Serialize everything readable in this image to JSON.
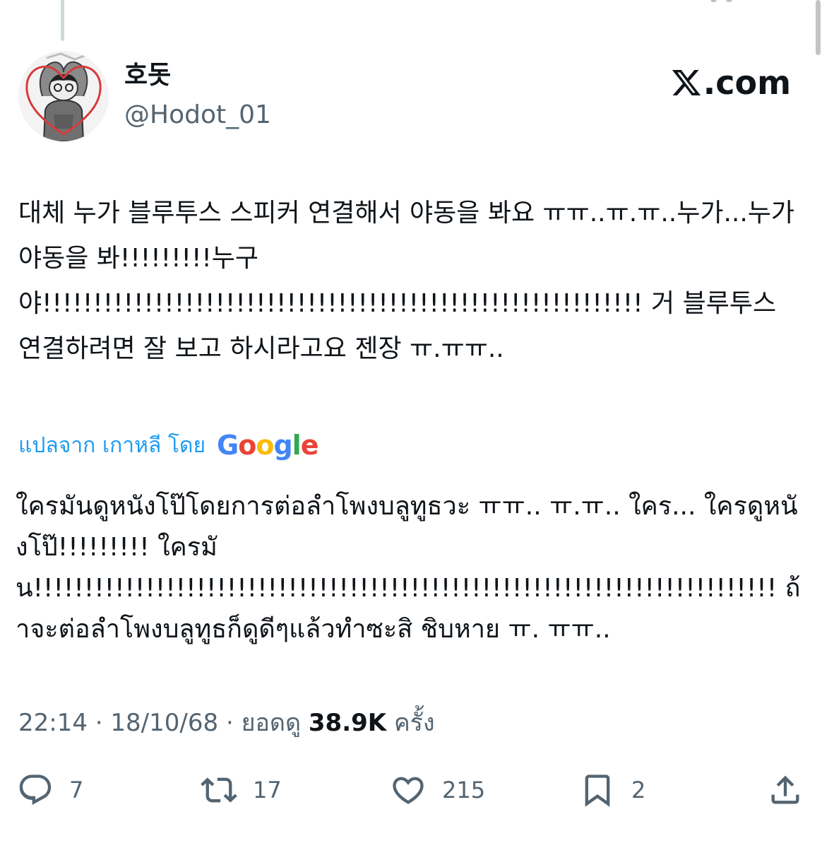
{
  "author": {
    "display_name": "호돗",
    "handle": "@Hodot_01"
  },
  "brand": {
    "label": ".com"
  },
  "tweet": {
    "text": "대체 누가 블루투스 스피커 연결해서 야동을 봐요 ㅠㅠ..ㅠ.ㅠ..누가...누가 야동을 봐!!!!!!!!!누구야!!!!!!!!!!!!!!!!!!!!!!!!!!!!!!!!!!!!!!!!!!!!!!!!!!!!!!!!!!! 거 블루투스 연결하려면 잘 보고 하시라고요 젠장 ㅠ.ㅠㅠ.."
  },
  "translation": {
    "label": "แปลจาก เกาหลี โดย",
    "provider": "Google",
    "text": "ใครมันดูหนังโป๊โดยการต่อลำโพงบลูทูธวะ ㅠㅠ.. ㅠ.ㅠ.. ใคร... ใครดูหนังโป๊!!!!!!!!! ใครมัน!!!!!!!!!!!!!!!!!!!!!!!!!!!!!!!!!!!!!!!!!!!!!!!!!!!!!!!!!!!!!!!!!!!!!!!!! ถ้าจะต่อลำโพงบลูทูธก็ดูดีๆแล้วทำซะสิ ชิบหาย ㅠ. ㅠㅠ.."
  },
  "meta": {
    "time": "22:14",
    "date": "18/10/68",
    "views_label": "ยอดดู",
    "views_count": "38.9K",
    "views_suffix": "ครั้ง"
  },
  "actions": {
    "replies": "7",
    "reposts": "17",
    "likes": "215",
    "bookmarks": "2"
  },
  "colors": {
    "link": "#1d9bf0",
    "secondary_text": "#536471",
    "primary_text": "#0f1419"
  },
  "icons": [
    "reply-icon",
    "repost-icon",
    "like-icon",
    "bookmark-icon",
    "share-icon",
    "x-logo-icon"
  ]
}
